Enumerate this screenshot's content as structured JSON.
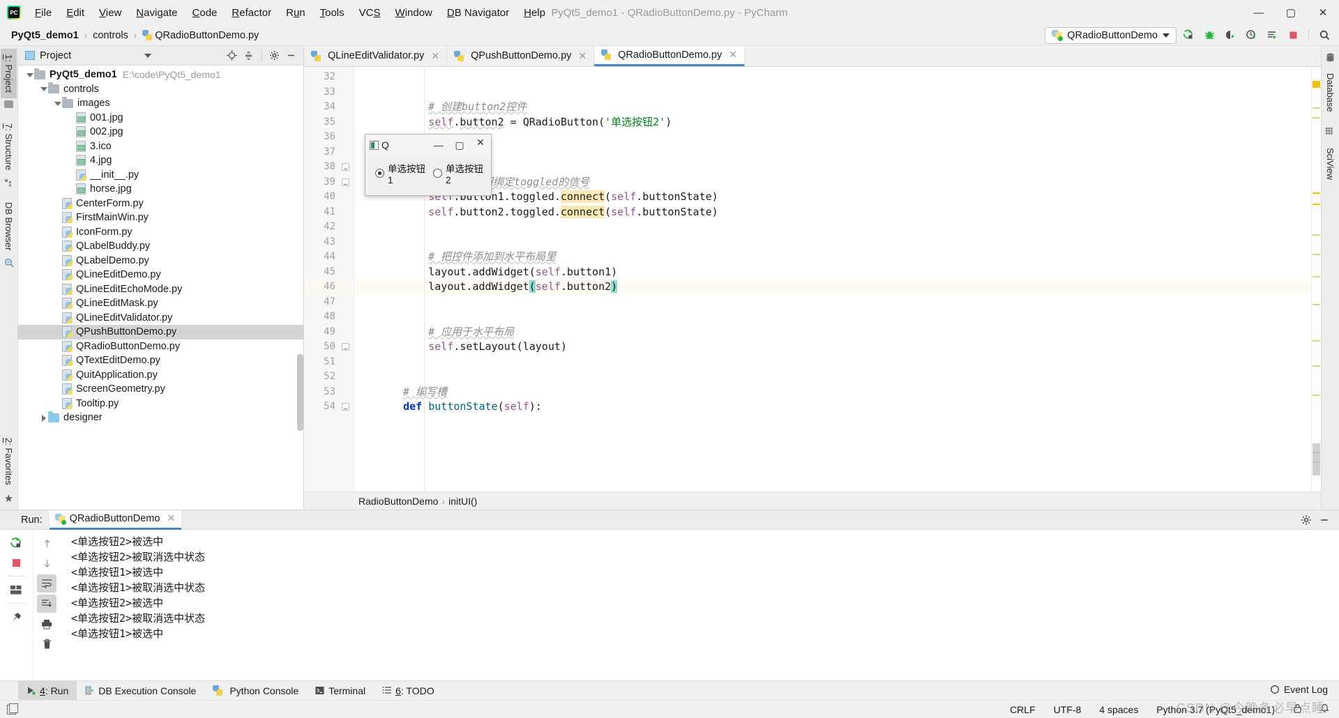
{
  "window": {
    "title": "PyQt5_demo1 - QRadioButtonDemo.py - PyCharm",
    "logo_icon": "pycharm-logo-icon",
    "minimize": "—",
    "maximize": "▢",
    "close": "✕"
  },
  "menubar": {
    "items": [
      {
        "label": "File",
        "mnemonic": "F"
      },
      {
        "label": "Edit",
        "mnemonic": "E"
      },
      {
        "label": "View",
        "mnemonic": "V"
      },
      {
        "label": "Navigate",
        "mnemonic": "N"
      },
      {
        "label": "Code",
        "mnemonic": "C"
      },
      {
        "label": "Refactor",
        "mnemonic": "R"
      },
      {
        "label": "Run",
        "mnemonic": "u"
      },
      {
        "label": "Tools",
        "mnemonic": "T"
      },
      {
        "label": "VCS",
        "mnemonic": "S"
      },
      {
        "label": "Window",
        "mnemonic": "W"
      },
      {
        "label": "DB Navigator",
        "mnemonic": "D"
      },
      {
        "label": "Help",
        "mnemonic": "H"
      }
    ]
  },
  "breadcrumb": {
    "items": [
      "PyQt5_demo1",
      "controls",
      "QRadioButtonDemo.py"
    ],
    "separator": "›"
  },
  "toolbar": {
    "run_config": "QRadioButtonDemo",
    "icons": [
      "run-icon",
      "debug-icon",
      "run-coverage-icon",
      "profile-icon",
      "run-with-console-icon",
      "stop-icon",
      "search-everywhere-icon"
    ]
  },
  "left_strip": {
    "tabs": [
      {
        "label": "1: Project",
        "mnemonic": "1",
        "icon": "project-folder-icon",
        "active": true
      },
      {
        "label": "7: Structure",
        "mnemonic": "7",
        "icon": "structure-icon",
        "active": false
      },
      {
        "label": "DB Browser",
        "mnemonic": "",
        "icon": "db-browser-icon",
        "active": false
      }
    ],
    "bottom_tabs": [
      {
        "label": "2: Favorites",
        "mnemonic": "2",
        "icon": "star-icon"
      }
    ]
  },
  "right_strip": {
    "tabs": [
      {
        "label": "Database",
        "icon": "database-icon"
      },
      {
        "label": "SciView",
        "icon": "sciview-icon"
      }
    ]
  },
  "project_panel": {
    "title": "Project",
    "actions": [
      "locate-icon",
      "collapse-all-icon",
      "settings-gear-icon",
      "hide-icon"
    ],
    "tree": [
      {
        "depth": 0,
        "label": "PyQt5_demo1",
        "path": "E:\\code\\PyQt5_demo1",
        "type": "folder",
        "arrow": "down",
        "bold": true,
        "selected": false
      },
      {
        "depth": 1,
        "label": "controls",
        "path": "",
        "type": "folder",
        "arrow": "down",
        "bold": false,
        "selected": false
      },
      {
        "depth": 2,
        "label": "images",
        "path": "",
        "type": "folder",
        "arrow": "down",
        "bold": false,
        "selected": false
      },
      {
        "depth": 3,
        "label": "001.jpg",
        "path": "",
        "type": "image",
        "arrow": "",
        "bold": false,
        "selected": false
      },
      {
        "depth": 3,
        "label": "002.jpg",
        "path": "",
        "type": "image",
        "arrow": "",
        "bold": false,
        "selected": false
      },
      {
        "depth": 3,
        "label": "3.ico",
        "path": "",
        "type": "image",
        "arrow": "",
        "bold": false,
        "selected": false
      },
      {
        "depth": 3,
        "label": "4.jpg",
        "path": "",
        "type": "image",
        "arrow": "",
        "bold": false,
        "selected": false
      },
      {
        "depth": 3,
        "label": "__init__.py",
        "path": "",
        "type": "python",
        "arrow": "",
        "bold": false,
        "selected": false
      },
      {
        "depth": 3,
        "label": "horse.jpg",
        "path": "",
        "type": "image",
        "arrow": "",
        "bold": false,
        "selected": false
      },
      {
        "depth": 2,
        "label": "CenterForm.py",
        "path": "",
        "type": "python",
        "arrow": "",
        "bold": false,
        "selected": false
      },
      {
        "depth": 2,
        "label": "FirstMainWin.py",
        "path": "",
        "type": "python",
        "arrow": "",
        "bold": false,
        "selected": false
      },
      {
        "depth": 2,
        "label": "IconForm.py",
        "path": "",
        "type": "python",
        "arrow": "",
        "bold": false,
        "selected": false
      },
      {
        "depth": 2,
        "label": "QLabelBuddy.py",
        "path": "",
        "type": "python",
        "arrow": "",
        "bold": false,
        "selected": false
      },
      {
        "depth": 2,
        "label": "QLabelDemo.py",
        "path": "",
        "type": "python",
        "arrow": "",
        "bold": false,
        "selected": false
      },
      {
        "depth": 2,
        "label": "QLineEditDemo.py",
        "path": "",
        "type": "python",
        "arrow": "",
        "bold": false,
        "selected": false
      },
      {
        "depth": 2,
        "label": "QLineEditEchoMode.py",
        "path": "",
        "type": "python",
        "arrow": "",
        "bold": false,
        "selected": false
      },
      {
        "depth": 2,
        "label": "QLineEditMask.py",
        "path": "",
        "type": "python",
        "arrow": "",
        "bold": false,
        "selected": false
      },
      {
        "depth": 2,
        "label": "QLineEditValidator.py",
        "path": "",
        "type": "python",
        "arrow": "",
        "bold": false,
        "selected": false
      },
      {
        "depth": 2,
        "label": "QPushButtonDemo.py",
        "path": "",
        "type": "python",
        "arrow": "",
        "bold": false,
        "selected": true
      },
      {
        "depth": 2,
        "label": "QRadioButtonDemo.py",
        "path": "",
        "type": "python",
        "arrow": "",
        "bold": false,
        "selected": false
      },
      {
        "depth": 2,
        "label": "QTextEditDemo.py",
        "path": "",
        "type": "python",
        "arrow": "",
        "bold": false,
        "selected": false
      },
      {
        "depth": 2,
        "label": "QuitApplication.py",
        "path": "",
        "type": "python",
        "arrow": "",
        "bold": false,
        "selected": false
      },
      {
        "depth": 2,
        "label": "ScreenGeometry.py",
        "path": "",
        "type": "python",
        "arrow": "",
        "bold": false,
        "selected": false
      },
      {
        "depth": 2,
        "label": "Tooltip.py",
        "path": "",
        "type": "python",
        "arrow": "",
        "bold": false,
        "selected": false
      },
      {
        "depth": 1,
        "label": "designer",
        "path": "",
        "type": "folder-blue",
        "arrow": "right",
        "bold": false,
        "selected": false
      }
    ]
  },
  "editor": {
    "tabs": [
      {
        "label": "QLineEditValidator.py",
        "active": false,
        "close": "✕"
      },
      {
        "label": "QPushButtonDemo.py",
        "active": false,
        "close": "✕"
      },
      {
        "label": "QRadioButtonDemo.py",
        "active": true,
        "close": "✕"
      }
    ],
    "first_line_number": 32,
    "current_line": 46,
    "lines": [
      {
        "n": 32,
        "text": ""
      },
      {
        "n": 33,
        "text": ""
      },
      {
        "n": 34,
        "text": "        # 创建button2控件",
        "kind": "comment"
      },
      {
        "n": 35,
        "text": "        self.button2 = QRadioButton('单选按钮2')",
        "kind": "code"
      },
      {
        "n": 36,
        "text": ""
      },
      {
        "n": 37,
        "text": ""
      },
      {
        "n": 38,
        "text": ""
      },
      {
        "n": 39,
        "text": "        # 为两个按钮绑定toggled的信号",
        "kind": "comment"
      },
      {
        "n": 40,
        "text": "        self.button1.toggled.connect(self.buttonState)",
        "kind": "code"
      },
      {
        "n": 41,
        "text": "        self.button2.toggled.connect(self.buttonState)",
        "kind": "code"
      },
      {
        "n": 42,
        "text": ""
      },
      {
        "n": 43,
        "text": ""
      },
      {
        "n": 44,
        "text": "        # 把控件添加到水平布局里",
        "kind": "comment"
      },
      {
        "n": 45,
        "text": "        layout.addWidget(self.button1)",
        "kind": "code"
      },
      {
        "n": 46,
        "text": "        layout.addWidget(self.button2)",
        "kind": "code"
      },
      {
        "n": 47,
        "text": ""
      },
      {
        "n": 48,
        "text": ""
      },
      {
        "n": 49,
        "text": "        # 应用于水平布局",
        "kind": "comment"
      },
      {
        "n": 50,
        "text": "        self.setLayout(layout)",
        "kind": "code"
      },
      {
        "n": 51,
        "text": ""
      },
      {
        "n": 52,
        "text": ""
      },
      {
        "n": 53,
        "text": "    # 编写槽",
        "kind": "comment"
      },
      {
        "n": 54,
        "text": "    def buttonState(self):",
        "kind": "code"
      }
    ],
    "breadcrumb": [
      "RadioButtonDemo",
      "initUI()"
    ],
    "breadcrumb_sep": "›"
  },
  "qt_dialog": {
    "title": "Q",
    "icon": "qt-app-icon",
    "minimize": "—",
    "maximize": "▢",
    "close": "✕",
    "radios": [
      {
        "label": "单选按钮1",
        "checked": true
      },
      {
        "label": "单选按钮2",
        "checked": false
      }
    ]
  },
  "run_panel": {
    "label": "Run:",
    "tab": "QRadioButtonDemo",
    "tab_close": "✕",
    "head_actions": [
      "settings-gear-icon",
      "hide-icon"
    ],
    "left_tools": [
      "rerun-icon",
      "stop-icon",
      "layout-icon",
      "pin-icon"
    ],
    "nav_tools": [
      "up-arrow-icon",
      "down-arrow-icon",
      "soft-wrap-icon",
      "scroll-to-end-icon",
      "print-icon",
      "trash-icon"
    ],
    "output": [
      "<单选按钮2>被选中",
      "<单选按钮2>被取消选中状态",
      "<单选按钮1>被选中",
      "<单选按钮1>被取消选中状态",
      "<单选按钮2>被选中",
      "<单选按钮2>被取消选中状态",
      "<单选按钮1>被选中"
    ]
  },
  "bottom_tabs": [
    {
      "label": "4: Run",
      "mnemonic": "4",
      "icon": "run-green-icon",
      "active": true
    },
    {
      "label": "DB Execution Console",
      "mnemonic": "",
      "icon": "db-console-icon",
      "active": false
    },
    {
      "label": "Python Console",
      "mnemonic": "",
      "icon": "python-icon",
      "active": false
    },
    {
      "label": "Terminal",
      "mnemonic": "",
      "icon": "terminal-icon",
      "active": false
    },
    {
      "label": "6: TODO",
      "mnemonic": "6",
      "icon": "todo-list-icon",
      "active": false
    }
  ],
  "status_bar": {
    "left_icon": "show-layout-icon",
    "event_log": "Event Log",
    "event_log_icon": "event-log-icon",
    "line_separator": "CRLF",
    "encoding": "UTF-8",
    "indent": "4 spaces",
    "interpreter": "Python 3.7 (PyQt5_demo1)",
    "lock_icon": "lock-icon",
    "bell_icon": "bell-icon"
  },
  "watermark": "CSDN @今晚条必早点睡",
  "colors": {
    "accent_blue": "#4386c7",
    "keyword": "#0033b3",
    "string": "#067d17",
    "comment": "#8c8c8c",
    "self": "#94558d",
    "function": "#00627a",
    "current_line": "#fcfaf2",
    "selection": "#8ed9d0",
    "usage_highlight": "#fbe9b3",
    "green_run": "#2fb344",
    "red_stop": "#e25563"
  }
}
